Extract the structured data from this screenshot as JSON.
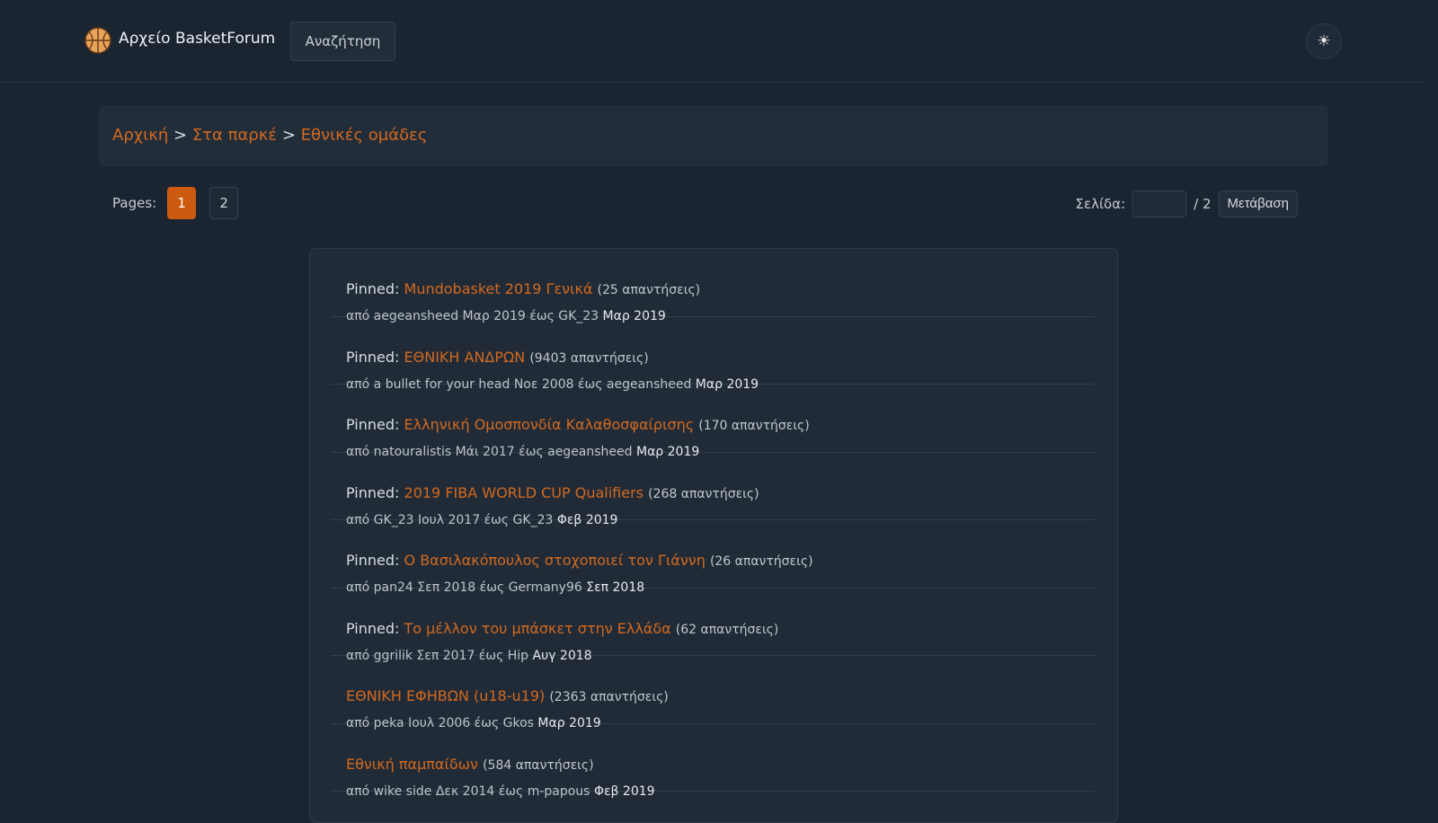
{
  "header": {
    "site_title": "Αρχείο BasketForum",
    "search_label": "Αναζήτηση",
    "logo_icon": "basketball-icon",
    "theme_icon": "sun-icon",
    "theme_glyph": "☀"
  },
  "breadcrumb": {
    "items": [
      "Αρχική",
      "Στα παρκέ",
      "Εθνικές ομάδες"
    ],
    "separator": ">"
  },
  "pagination": {
    "label": "Pages:",
    "pages": [
      "1",
      "2"
    ],
    "current": "1",
    "jump_label": "Σελίδα:",
    "jump_total": "/ 2",
    "jump_button": "Μετάβαση"
  },
  "topics": [
    {
      "prefix": "Pinned:",
      "title": "Mundobasket 2019 Γενικά",
      "replies": "(25 απαντήσεις)",
      "meta": "από aegeansheed Μαρ 2019 έως GK_23",
      "last_date": "Μαρ 2019"
    },
    {
      "prefix": "Pinned:",
      "title": "ΕΘΝΙΚΗ ΑΝΔΡΩΝ",
      "replies": "(9403 απαντήσεις)",
      "meta": "από a bullet for your head Νοε 2008 έως aegeansheed",
      "last_date": "Μαρ 2019"
    },
    {
      "prefix": "Pinned:",
      "title": "Ελληνική Ομοσπονδία Καλαθοσφαίρισης",
      "replies": "(170 απαντήσεις)",
      "meta": "από natouralistis Μάι 2017 έως aegeansheed",
      "last_date": "Μαρ 2019"
    },
    {
      "prefix": "Pinned:",
      "title": "2019 FIBA WORLD CUP Qualifiers",
      "replies": "(268 απαντήσεις)",
      "meta": "από GK_23 Ιουλ 2017 έως GK_23",
      "last_date": "Φεβ 2019"
    },
    {
      "prefix": "Pinned:",
      "title": "Ο Βασιλακόπουλος στοχοποιεί τον Γιάννη",
      "replies": "(26 απαντήσεις)",
      "meta": "από pan24 Σεπ 2018 έως Germany96",
      "last_date": "Σεπ 2018"
    },
    {
      "prefix": "Pinned:",
      "title": "Το μέλλον του μπάσκετ στην Ελλάδα",
      "replies": "(62 απαντήσεις)",
      "meta": "από ggrilik Σεπ 2017 έως Hip",
      "last_date": "Αυγ 2018"
    },
    {
      "prefix": "",
      "title": "ΕΘΝΙΚΗ ΕΦΗΒΩΝ (u18-u19)",
      "replies": "(2363 απαντήσεις)",
      "meta": "από peka Ιουλ 2006 έως Gkos",
      "last_date": "Μαρ 2019"
    },
    {
      "prefix": "",
      "title": "Εθνική παμπαίδων",
      "replies": "(584 απαντήσεις)",
      "meta": "από wike side Δεκ 2014 έως m-papous",
      "last_date": "Φεβ 2019"
    }
  ],
  "colors": {
    "background": "#1b2532",
    "accent": "#d2691e",
    "active_page": "#cc5a0f",
    "panel": "#212b38"
  }
}
